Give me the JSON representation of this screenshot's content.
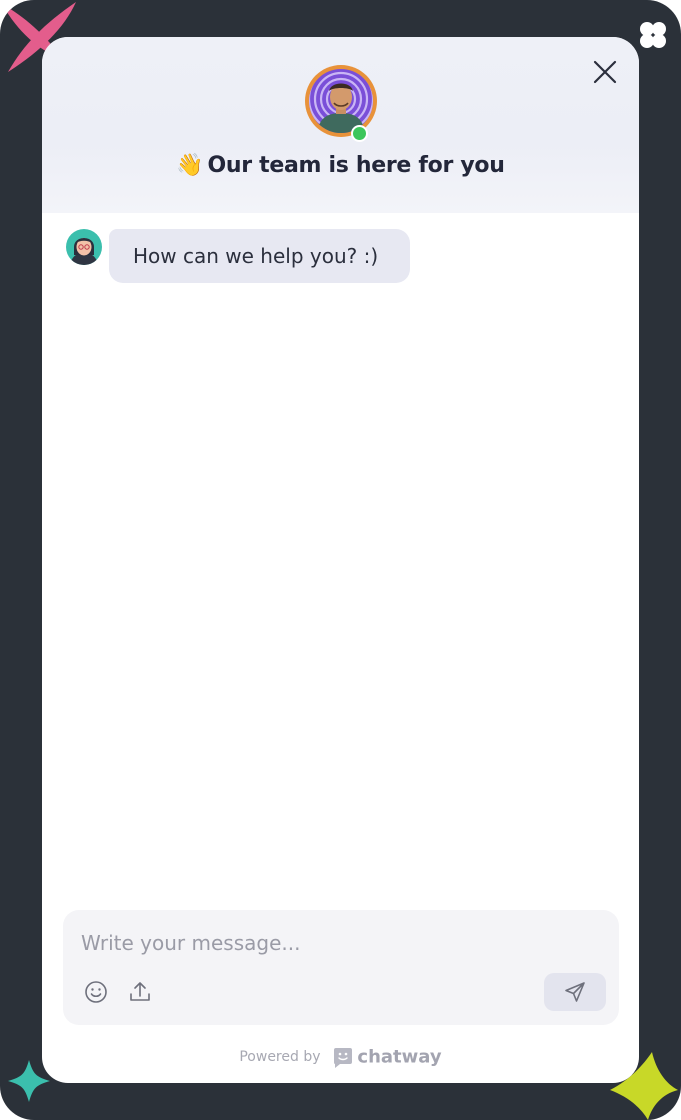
{
  "header": {
    "title": "Our team is here for you",
    "wave_emoji": "👋",
    "agent_status": "online"
  },
  "messages": [
    {
      "sender": "agent",
      "text": "How can we help you? :)"
    }
  ],
  "composer": {
    "placeholder": "Write your message...",
    "value": ""
  },
  "footer": {
    "powered_by_label": "Powered by",
    "brand_name": "chatway"
  },
  "icons": {
    "close": "close-icon",
    "emoji": "emoji-icon",
    "upload": "upload-icon",
    "send": "send-icon",
    "brand": "chatway-logo-icon"
  },
  "colors": {
    "frame_bg": "#2b3139",
    "header_bg": "#eceef6",
    "bubble_bg": "#e7e8f2",
    "online": "#3cc65a",
    "avatar_ring": "#e8923a",
    "deco_pink": "#e35d8c",
    "deco_teal": "#3bbfad",
    "deco_lime": "#c8d828"
  }
}
